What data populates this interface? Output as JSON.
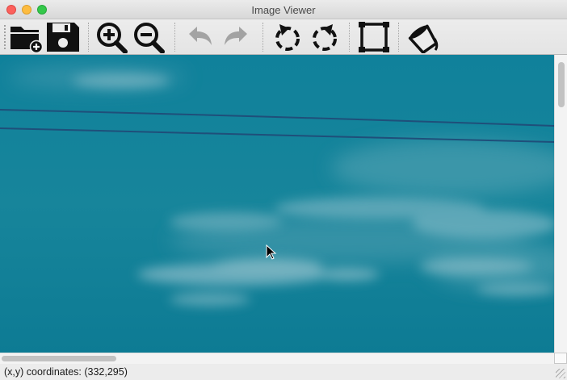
{
  "window": {
    "title": "Image Viewer",
    "traffic_lights": [
      "close",
      "minimize",
      "maximize"
    ]
  },
  "toolbar": {
    "buttons": [
      {
        "name": "open-folder",
        "icon": "folder-add-icon",
        "enabled": true
      },
      {
        "name": "save",
        "icon": "floppy-disk-icon",
        "enabled": true
      },
      {
        "name": "zoom-in",
        "icon": "zoom-in-icon",
        "enabled": true
      },
      {
        "name": "zoom-out",
        "icon": "zoom-out-icon",
        "enabled": true
      },
      {
        "name": "undo",
        "icon": "undo-arrow-icon",
        "enabled": false
      },
      {
        "name": "redo",
        "icon": "redo-arrow-icon",
        "enabled": false
      },
      {
        "name": "rotate-left",
        "icon": "rotate-left-icon",
        "enabled": true
      },
      {
        "name": "rotate-right",
        "icon": "rotate-right-icon",
        "enabled": true
      },
      {
        "name": "crop",
        "icon": "crop-frame-icon",
        "enabled": true
      },
      {
        "name": "fill",
        "icon": "paint-bucket-icon",
        "enabled": true
      }
    ]
  },
  "image": {
    "subject": "sky-with-power-lines",
    "sky_color": "#0e7f99",
    "cloud_color": "#7fb6c2",
    "line_color": "#1f4f7a"
  },
  "scroll": {
    "horizontal_fraction": 0.21,
    "vertical_fraction": 0.15
  },
  "status": {
    "coordinates_text": "(x,y) coordinates: (332,295)"
  }
}
